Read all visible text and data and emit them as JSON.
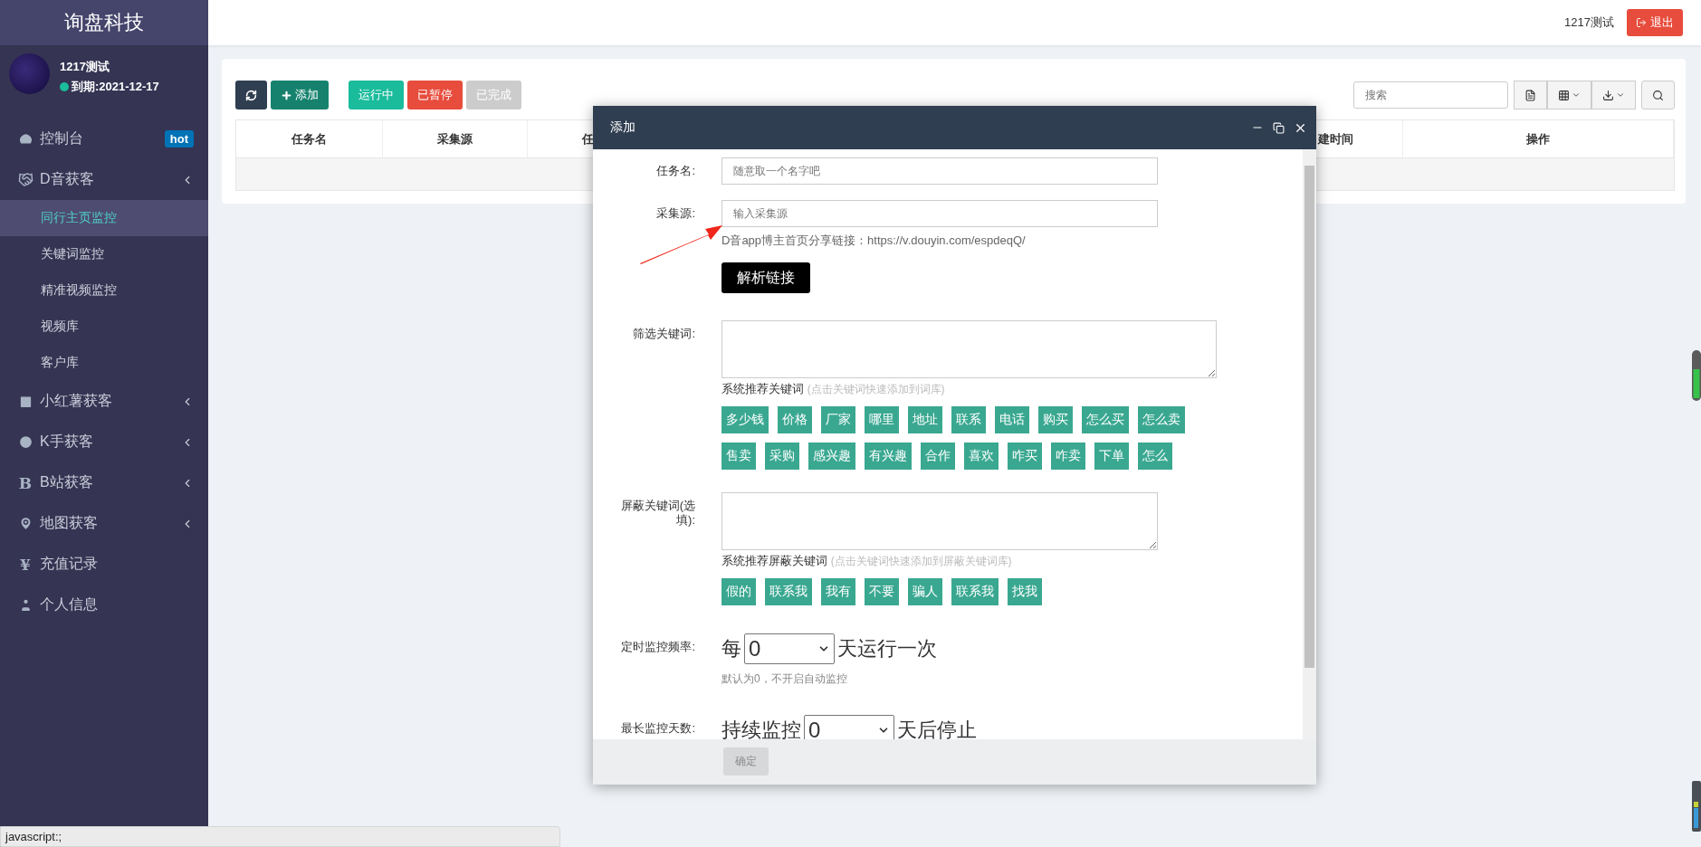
{
  "brand": "询盘科技",
  "user": {
    "name": "1217测试",
    "expiry": "到期:2021-12-17",
    "online": true
  },
  "menu": [
    {
      "label": "控制台",
      "badge": "hot",
      "submenu": false
    },
    {
      "label": "D音获客",
      "submenu": true,
      "children": [
        {
          "label": "同行主页监控",
          "selected": true
        },
        {
          "label": "关键词监控",
          "selected": false
        },
        {
          "label": "精准视频监控",
          "selected": false
        },
        {
          "label": "视频库",
          "selected": false
        },
        {
          "label": "客户库",
          "selected": false
        }
      ]
    },
    {
      "label": "小红薯获客",
      "submenu": true
    },
    {
      "label": "K手获客",
      "submenu": true
    },
    {
      "label": "B站获客",
      "icon_text": "B",
      "submenu": true
    },
    {
      "label": "地图获客",
      "submenu": true
    },
    {
      "label": "充值记录",
      "icon_text": "¥",
      "submenu": false
    },
    {
      "label": "个人信息",
      "submenu": false
    }
  ],
  "topbar": {
    "user": "1217测试",
    "logout": "退出"
  },
  "toolbar": {
    "add": "添加",
    "filters": [
      {
        "label": "运行中",
        "color": "#1abc9c"
      },
      {
        "label": "已暂停",
        "color": "#e74c3c"
      },
      {
        "label": "已完成",
        "color": "#cccccc"
      }
    ],
    "search": {
      "placeholder": "搜索"
    }
  },
  "table": {
    "columns": [
      "任务名",
      "采集源",
      "任",
      "建时间",
      "操作"
    ]
  },
  "dialog": {
    "title": "添加",
    "fields": [
      {
        "kind": "input",
        "label": "任务名:",
        "placeholder": "随意取一个名字吧"
      },
      {
        "kind": "input",
        "label": "采集源:",
        "placeholder": "输入采集源",
        "hint": "D音app博主首页分享链接：https://v.douyin.com/espdeqQ/",
        "button": "解析链接",
        "pointer": true
      },
      {
        "kind": "keywords",
        "label": "筛选关键词:",
        "suggest_title": "系统推荐关键词",
        "suggest_note": "(点击关键词快速添加到词库)",
        "tag_rows": [
          [
            "多少钱",
            "价格",
            "厂家",
            "哪里",
            "地址",
            "联系",
            "电话",
            "购买",
            "怎么买",
            "怎么卖"
          ],
          [
            "售卖",
            "采购",
            "感兴趣",
            "有兴趣",
            "合作",
            "喜欢",
            "咋买",
            "咋卖",
            "下单",
            "怎么"
          ]
        ]
      },
      {
        "kind": "keywords",
        "label": "屏蔽关键词(选填):",
        "suggest_title": "系统推荐屏蔽关键词",
        "suggest_note": "(点击关键词快速添加到屏蔽关键词库)",
        "tag_rows": [
          [
            "假的",
            "联系我",
            "我有",
            "不要",
            "骗人",
            "联系我",
            "找我"
          ]
        ]
      },
      {
        "kind": "select",
        "label": "定时监控频率:",
        "prefix": "每",
        "value": "0",
        "suffix": "天运行一次",
        "hint": "默认为0，不开启自动监控"
      },
      {
        "kind": "select",
        "label": "最长监控天数:",
        "prefix": "持续监控",
        "value": "0",
        "suffix": "天后停止"
      }
    ],
    "confirm": {
      "label": "确定",
      "disabled": true
    }
  },
  "status_bar": "javascript:;"
}
